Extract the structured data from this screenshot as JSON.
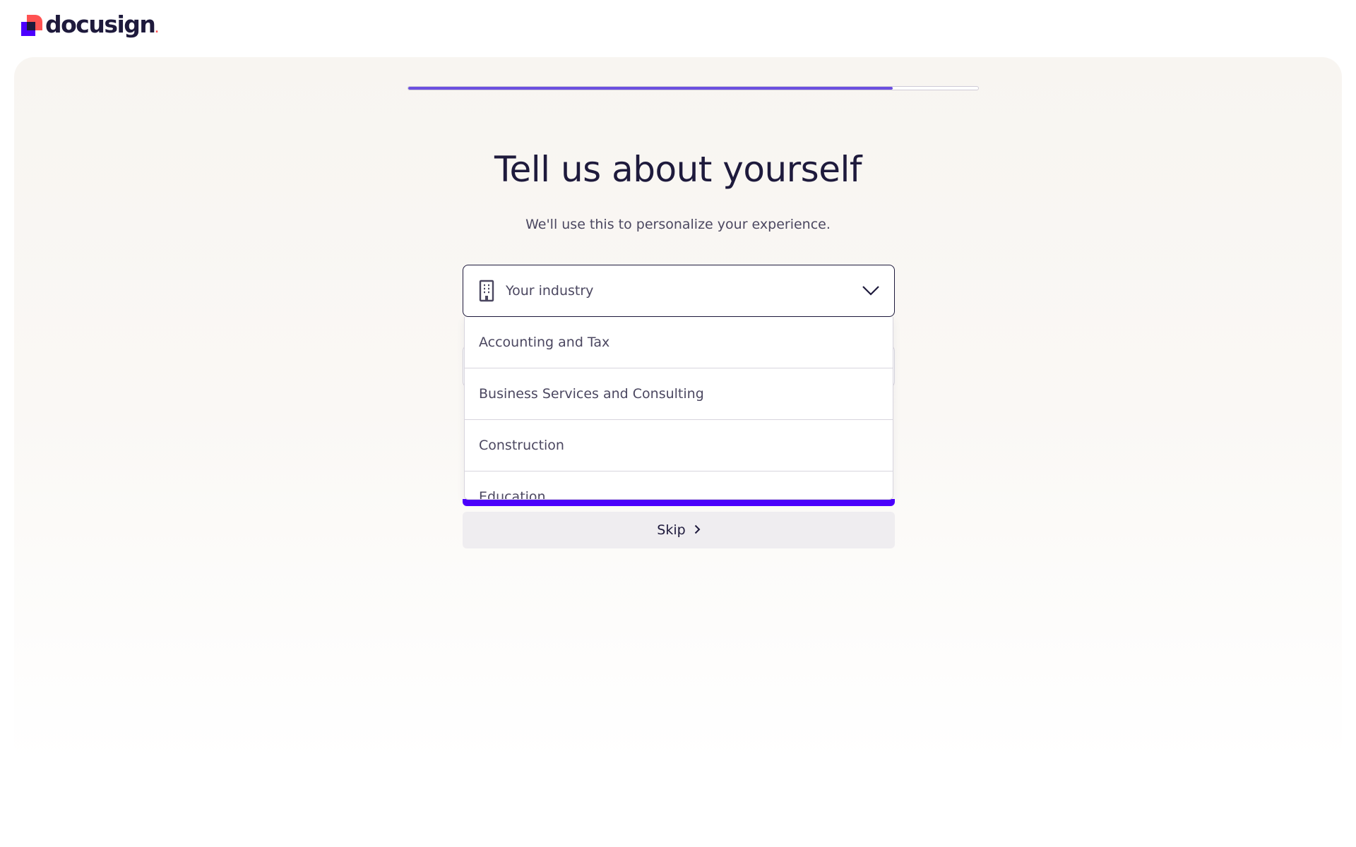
{
  "header": {
    "logo_text": "docusign",
    "logo_dot": "."
  },
  "progress": {
    "value_percent": 85
  },
  "main": {
    "title": "Tell us about yourself",
    "subtitle": "We'll use this to personalize your experience."
  },
  "industry_select": {
    "placeholder": "Your industry",
    "icon": "building-icon",
    "options": [
      "Accounting and Tax",
      "Business Services and Consulting",
      "Construction",
      "Education"
    ]
  },
  "actions": {
    "skip_label": "Skip"
  },
  "colors": {
    "primary": "#4c00ff",
    "progress": "#6b4fe0",
    "text": "#1e1a3c",
    "logo_red": "#ff5252"
  }
}
